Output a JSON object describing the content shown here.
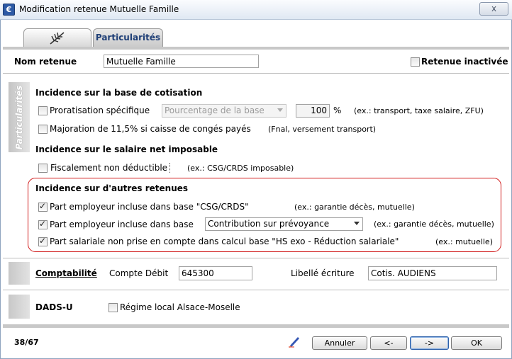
{
  "window": {
    "title": "Modification retenue Mutuelle Famille",
    "app_icon": "app-icon",
    "close_label": "x"
  },
  "tabs": [
    {
      "label": "",
      "icon": "feather-icon"
    },
    {
      "label": "Particularités"
    }
  ],
  "header": {
    "nom_label": "Nom retenue",
    "nom_value": "Mutuelle Famille",
    "inactive_label": "Retenue inactivée",
    "inactive_checked": false
  },
  "sidebar_label": "Particularités",
  "base_cotisation": {
    "title": "Incidence sur la base de cotisation",
    "proratisation_label": "Proratisation spécifique",
    "proratisation_checked": false,
    "proratisation_select": "Pourcentage de la base",
    "proratisation_value": "100",
    "percent_sign": "%",
    "proratisation_hint": "(ex.: transport, taxe salaire, ZFU)",
    "majoration_label": "Majoration de 11,5% si caisse de congés payés",
    "majoration_checked": false,
    "majoration_hint": "(Fnal, versement transport)"
  },
  "salaire_net": {
    "title": "Incidence sur le salaire net imposable",
    "fiscal_label": "Fiscalement non déductible",
    "fiscal_checked": false,
    "fiscal_hint": "(ex.: CSG/CRDS imposable)"
  },
  "autres_retenues": {
    "title": "Incidence sur d'autres retenues",
    "items": [
      {
        "label": "Part employeur incluse dans base \"CSG/CRDS\"",
        "hint": "(ex.: garantie décès, mutuelle)",
        "checked": true
      },
      {
        "label": "Part employeur incluse dans base",
        "select": "Contribution sur prévoyance",
        "hint": "(ex.: garantie décès, mutuelle)",
        "checked": true
      },
      {
        "label": "Part salariale non prise en compte dans calcul base \"HS exo - Réduction salariale\"",
        "hint": "(ex.: mutuelle)",
        "checked": true
      }
    ]
  },
  "comptabilite": {
    "title": "Comptabilité",
    "compte_label": "Compte Débit",
    "compte_value": "645300",
    "libelle_label": "Libellé écriture",
    "libelle_value": "Cotis. AUDIENS"
  },
  "dadsu": {
    "title": "DADS-U",
    "regime_label": "Régime local Alsace-Moselle",
    "regime_checked": false
  },
  "footer": {
    "counter": "38/67",
    "edit_icon": "pencil-icon",
    "annuler": "Annuler",
    "prev": "<-",
    "next": "->",
    "ok": "OK"
  }
}
